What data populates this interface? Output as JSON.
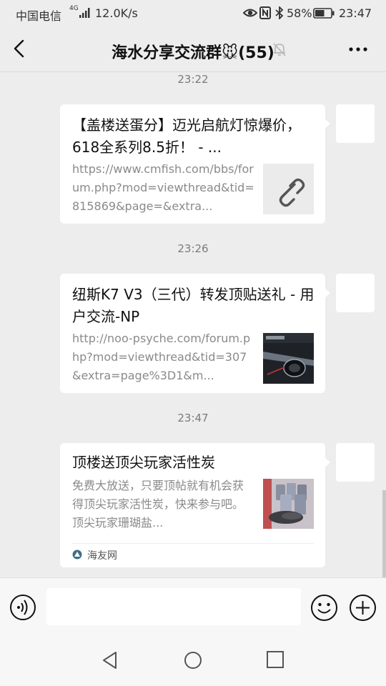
{
  "status_bar": {
    "carrier": "中国电信",
    "network_icon": "4G",
    "speed": "12.0K/s",
    "battery": "58%",
    "time": "23:47"
  },
  "title_bar": {
    "title": "海水分享交流群🐭(55)",
    "icons": [
      "back-arrow-icon",
      "mute-bell-icon",
      "more-icon"
    ]
  },
  "messages": [
    {
      "time": "23:22",
      "title": "【盖楼送蛋分】迈光启航灯惊爆价，618全系列8.5折！ - ...",
      "desc": "https://www.cmfish.com/bbs/forum.php?mod=viewthread&tid=815869&page=&extra...",
      "thumb": "link-icon"
    },
    {
      "time": "23:26",
      "title": "纽斯K7 V3（三代）转发顶贴送礼 - 用户交流-NP",
      "desc": "http://noo-psyche.com/forum.php?mod=viewthread&tid=307&extra=page%3D1&m...",
      "thumb": "aquarium-light-image"
    },
    {
      "time": "23:47",
      "title": "顶楼送顶尖玩家活性炭",
      "desc": "免费大放送，只要顶帖就有机会获得顶尖玩家活性炭，快来参与吧。顶尖玩家珊瑚盐...",
      "thumb": "activated-carbon-image",
      "source": "海友网"
    }
  ],
  "input_bar": {
    "placeholder": "",
    "icons": [
      "voice-icon",
      "emoji-icon",
      "plus-icon"
    ]
  },
  "colors": {
    "background": "#ededed",
    "bubble": "#ffffff",
    "timestamp": "#7b7b7b",
    "description": "#8a8a8a"
  }
}
